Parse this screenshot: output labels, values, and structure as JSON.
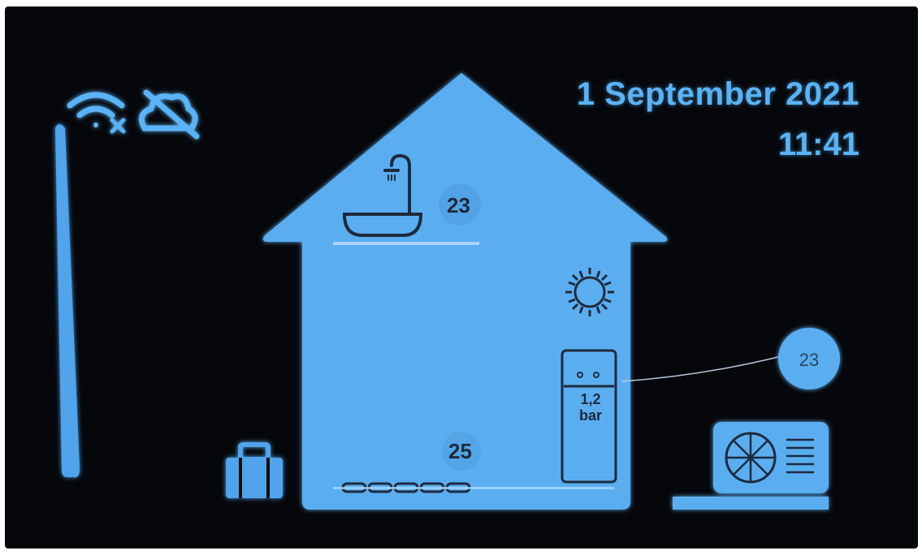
{
  "status_bar": {
    "wifi_icon": "wifi-disconnected-icon",
    "cloud_icon": "cloud-off-icon"
  },
  "datetime": {
    "date": "1 September 2021",
    "time": "11:41"
  },
  "house": {
    "upper_temperature": "23",
    "lower_temperature": "25",
    "bath_icon": "bathtub-shower-icon",
    "sun_icon": "sun-icon",
    "boiler_icon": "boiler-icon",
    "pressure_value": "1,2",
    "pressure_unit": "bar",
    "floor_heating_icon": "floor-heating-icon"
  },
  "outdoor": {
    "temperature": "23",
    "heat_pump_icon": "heat-pump-outdoor-unit-icon"
  },
  "away_icon": "suitcase-icon",
  "colors": {
    "background": "#06070b",
    "accent": "#5ab3f5",
    "house_fill": "#5aaef0",
    "dark_text": "#1e2a3c"
  }
}
